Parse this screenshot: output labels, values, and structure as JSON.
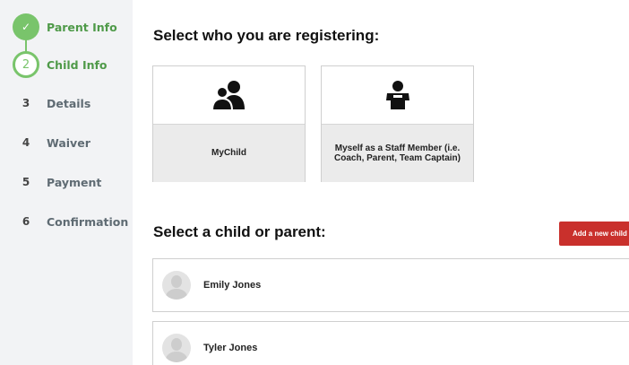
{
  "steps": [
    {
      "number": "✓",
      "label": "Parent Info",
      "state": "done"
    },
    {
      "number": "2",
      "label": "Child Info",
      "state": "active"
    },
    {
      "number": "3",
      "label": "Details",
      "state": "pending"
    },
    {
      "number": "4",
      "label": "Waiver",
      "state": "pending"
    },
    {
      "number": "5",
      "label": "Payment",
      "state": "pending"
    },
    {
      "number": "6",
      "label": "Confirmation",
      "state": "pending"
    }
  ],
  "registering": {
    "heading": "Select who you are registering:",
    "options": [
      {
        "label": "MyChild",
        "icon": "users-icon"
      },
      {
        "label": "Myself as a Staff Member (i.e. Coach, Parent, Team Captain)",
        "icon": "staff-icon"
      }
    ]
  },
  "select_person": {
    "heading": "Select a child or parent:",
    "add_button": "Add a new child",
    "people": [
      {
        "name": "Emily Jones"
      },
      {
        "name": "Tyler Jones"
      }
    ]
  },
  "colors": {
    "accent_green": "#79c46b",
    "button_red": "#c9302c",
    "sidebar_bg": "#f2f3f5"
  }
}
